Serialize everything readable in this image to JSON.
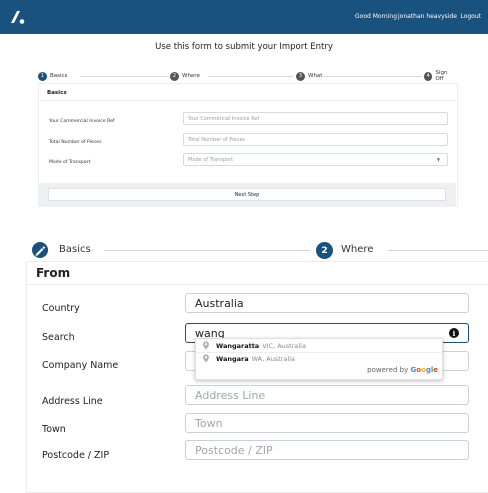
{
  "header": {
    "greeting": "Good Morning",
    "user_name": "jonathan heavyside",
    "logout_label": "Logout",
    "brand_color": "#1a527f"
  },
  "page": {
    "title": "Use this form to submit your Import Entry"
  },
  "steps": [
    {
      "num": "1",
      "label": "Basics"
    },
    {
      "num": "2",
      "label": "Where"
    },
    {
      "num": "3",
      "label": "What"
    },
    {
      "num": "4",
      "label": "Sign Off"
    }
  ],
  "basics": {
    "section_title": "Basics",
    "fields": [
      {
        "label": "Your Commercial Invoice Ref",
        "placeholder": "Your Commercial Invoice Ref"
      },
      {
        "label": "Total Number of Pieces",
        "placeholder": "Total Number of Pieces"
      },
      {
        "label": "Mode of Transport",
        "placeholder": "Mode of Transport"
      }
    ],
    "next_label": "Next Step"
  },
  "zoom": {
    "step1_label": "Basics",
    "step2_num": "2",
    "step2_label": "Where",
    "section_title": "From",
    "fields": {
      "country": {
        "label": "Country",
        "value": "Australia"
      },
      "search": {
        "label": "Search",
        "value": "wang"
      },
      "company": {
        "label": "Company Name"
      },
      "address": {
        "label": "Address Line",
        "placeholder": "Address Line"
      },
      "town": {
        "label": "Town",
        "placeholder": "Town"
      },
      "postcode": {
        "label": "Postcode / ZIP",
        "placeholder": "Postcode / ZIP"
      }
    },
    "suggestions": [
      {
        "bold": "Wangaratta",
        "rest": "VIC, Australia"
      },
      {
        "bold": "Wangara",
        "rest": "WA, Australia"
      }
    ],
    "powered_by": "powered by",
    "google_letters": [
      "G",
      "o",
      "o",
      "g",
      "l",
      "e"
    ],
    "google_colors": [
      "#4285F4",
      "#EA4335",
      "#FBBC05",
      "#4285F4",
      "#34A853",
      "#EA4335"
    ]
  }
}
